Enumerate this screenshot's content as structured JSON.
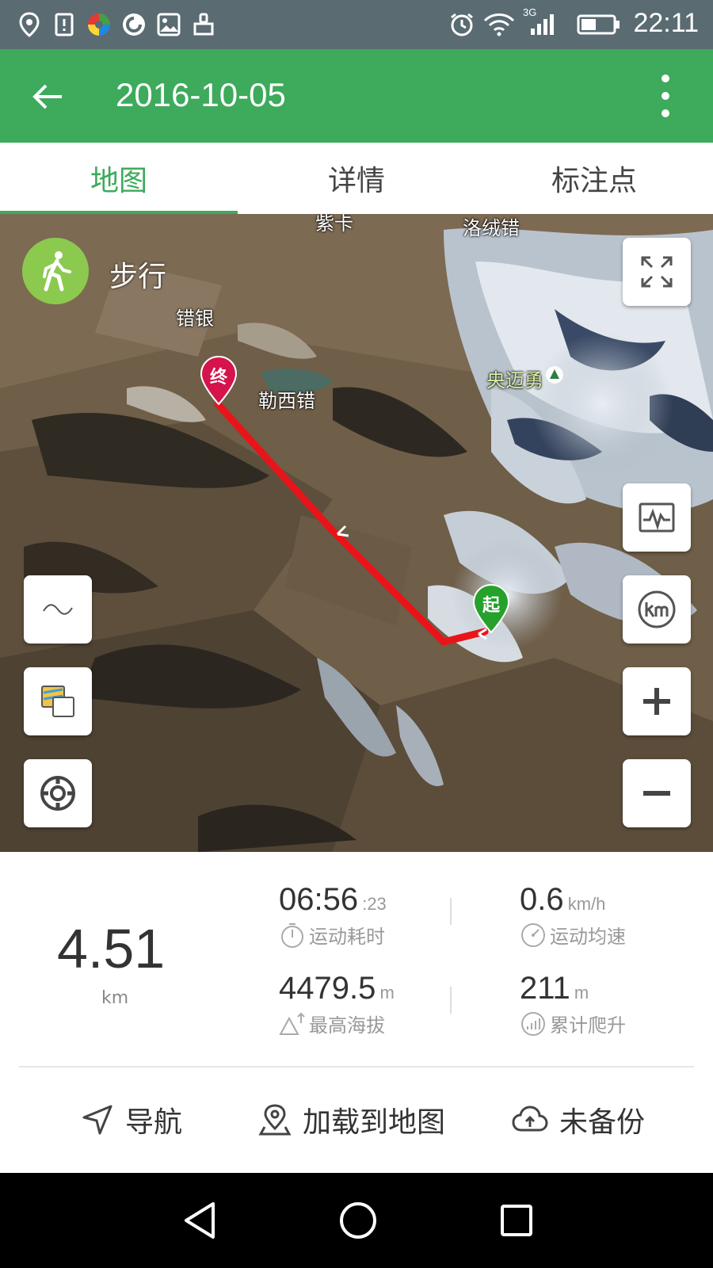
{
  "status_bar": {
    "time": "22:11",
    "network": "3G",
    "icons": [
      "location-icon",
      "sim-alert-icon",
      "app-icon",
      "music-icon",
      "gallery-icon",
      "cleaner-icon",
      "alarm-icon",
      "wifi-icon",
      "signal-icon",
      "battery-icon"
    ]
  },
  "app_bar": {
    "title": "2016-10-05",
    "accent": "#3daa5c"
  },
  "tabs": [
    {
      "label": "地图",
      "active": true
    },
    {
      "label": "详情",
      "active": false
    },
    {
      "label": "标注点",
      "active": false
    }
  ],
  "map": {
    "mode_label": "步行",
    "place_labels": {
      "top_partial": "紫卡",
      "luorong": "洛绒错",
      "cuoyin": "错银",
      "lexi": "勒西错",
      "yangmaiyong": "央迈勇"
    },
    "start_marker": "起",
    "end_marker": "终",
    "route_color": "#e8141a"
  },
  "stats": {
    "distance": {
      "value": "4.51",
      "unit": "km"
    },
    "duration": {
      "value": "06:56",
      "sub": ":23",
      "label": "运动耗时"
    },
    "avg_speed": {
      "value": "0.6",
      "unit": "km/h",
      "label": "运动均速"
    },
    "max_altitude": {
      "value": "4479.5",
      "unit": "m",
      "label": "最高海拔"
    },
    "total_climb": {
      "value": "211",
      "unit": "m",
      "label": "累计爬升"
    }
  },
  "actions": {
    "navigate": "导航",
    "load_to_map": "加载到地图",
    "backup": "未备份"
  }
}
